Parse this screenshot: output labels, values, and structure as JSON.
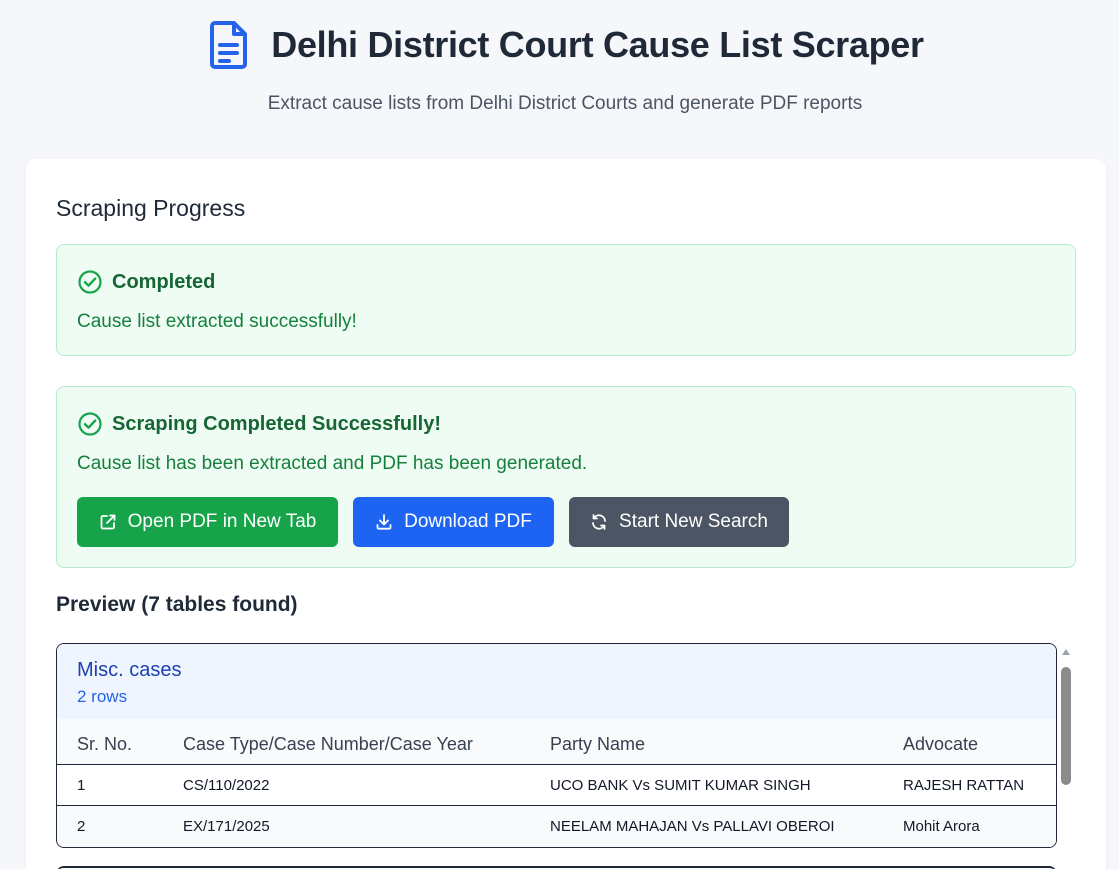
{
  "header": {
    "title": "Delhi District Court Cause List Scraper",
    "subtitle": "Extract cause lists from Delhi District Courts and generate PDF reports",
    "icon": "document-icon"
  },
  "progress": {
    "section_title": "Scraping Progress",
    "status_title": "Completed",
    "status_message": "Cause list extracted successfully!"
  },
  "result": {
    "title": "Scraping Completed Successfully!",
    "message": "Cause list has been extracted and PDF has been generated.",
    "buttons": {
      "open_pdf": "Open PDF in New Tab",
      "download_pdf": "Download PDF",
      "new_search": "Start New Search"
    }
  },
  "preview": {
    "title": "Preview (7 tables found)",
    "tables": [
      {
        "name": "Misc. cases",
        "row_count": "2 rows",
        "columns": [
          "Sr. No.",
          "Case Type/Case Number/Case Year",
          "Party Name",
          "Advocate"
        ],
        "rows": [
          [
            "1",
            "CS/110/2022",
            "UCO BANK Vs SUMIT KUMAR SINGH",
            "RAJESH RATTAN"
          ],
          [
            "2",
            "EX/171/2025",
            "NEELAM MAHAJAN Vs PALLAVI OBEROI",
            "Mohit Arora"
          ]
        ]
      }
    ]
  },
  "colors": {
    "success_bg": "#effcf3",
    "success_text": "#15803d",
    "open_button": "#16a34a",
    "download_button": "#1d64f2",
    "new_search_button": "#4b5563",
    "title_icon": "#2563eb"
  }
}
